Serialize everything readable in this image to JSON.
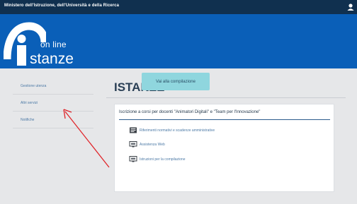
{
  "topbar": {
    "title": "Ministero dell'Istruzione, dell'Università e della Ricerca"
  },
  "logo": {
    "online": "on line",
    "istanze": "stanze"
  },
  "sidebar": {
    "items": [
      {
        "label": "Gestione utenza"
      },
      {
        "label": "Altri servizi"
      },
      {
        "label": "Notifiche"
      }
    ]
  },
  "main": {
    "title": "ISTANZE",
    "panel": {
      "heading": "Iscrizione a corsi per docenti \"Animatori Digitali\" e \"Team per l'Innovazione\"",
      "links": [
        {
          "label": "Riferimenti normativi e scadenze amministrative",
          "icon": "document-icon"
        },
        {
          "label": "Assistenza Web",
          "icon": "monitor-icon"
        },
        {
          "label": "Istruzioni per la compilazione",
          "icon": "monitor-icon"
        }
      ],
      "button_label": "Vai alla compilazione"
    }
  },
  "colors": {
    "topbar": "#10304f",
    "header": "#0a5fb8",
    "accent_button": "#8fd6de",
    "annotation_arrow": "#e0252a"
  }
}
